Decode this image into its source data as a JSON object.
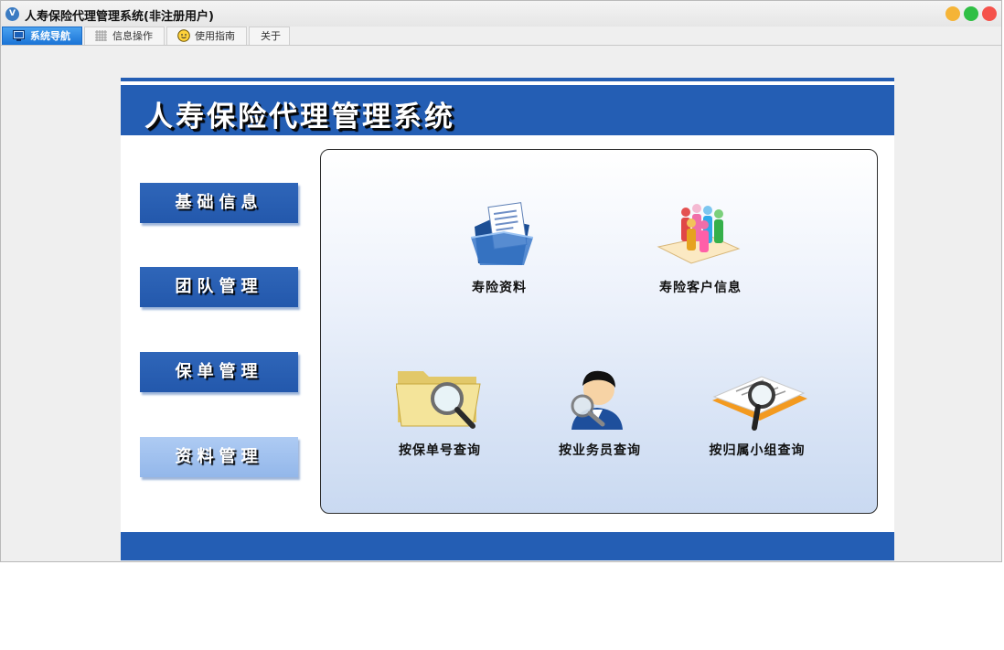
{
  "window": {
    "title": "人寿保险代理管理系统(非注册用户)",
    "app_icon_text": "V"
  },
  "tabs": [
    {
      "label": "系统导航",
      "active": true
    },
    {
      "label": "信息操作",
      "active": false
    },
    {
      "label": "使用指南",
      "active": false
    },
    {
      "label": "关于",
      "active": false
    }
  ],
  "header": {
    "title": "人寿保险代理管理系统"
  },
  "nav": [
    {
      "label": "基础信息"
    },
    {
      "label": "团队管理"
    },
    {
      "label": "保单管理"
    },
    {
      "label": "资料管理",
      "active": true
    }
  ],
  "items": [
    {
      "label": "寿险资料",
      "icon": "document-folder-icon"
    },
    {
      "label": "寿险客户信息",
      "icon": "customers-group-icon"
    },
    {
      "label": "按保单号查询",
      "icon": "folder-search-icon"
    },
    {
      "label": "按业务员查询",
      "icon": "agent-search-icon"
    },
    {
      "label": "按归属小组查询",
      "icon": "book-search-icon"
    }
  ],
  "colors": {
    "header_blue": "#245eb4",
    "tab_active": "#1a73d6",
    "nav_active": "#a5c4f0"
  }
}
